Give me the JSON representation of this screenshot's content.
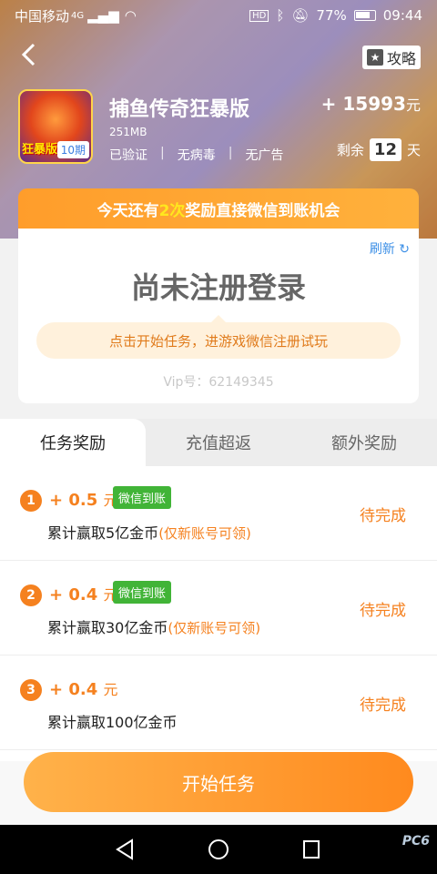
{
  "status": {
    "carrier": "中国移动",
    "network": "4G",
    "hd": "HD",
    "battery": "77%",
    "time": "09:44"
  },
  "header": {
    "guide_label": "攻略"
  },
  "game": {
    "title": "捕鱼传奇狂暴版",
    "size": "251MB",
    "badges": [
      "已验证",
      "无病毒",
      "无广告"
    ],
    "icon_tag": "10期",
    "icon_ribbon": "狂暴版",
    "reward_prefix": "+",
    "reward_value": "15993",
    "reward_unit": "元",
    "remain_label": "剩余",
    "remain_days": "12",
    "remain_unit": "天"
  },
  "banner": {
    "prefix": "今天还有",
    "count": "2次",
    "suffix": "奖励直接微信到账机会"
  },
  "card": {
    "refresh_label": "刷新",
    "headline": "尚未注册登录",
    "tip": "点击开始任务，进游戏微信注册试玩",
    "vip": "Vip号：62149345"
  },
  "tabs": [
    {
      "label": "任务奖励",
      "active": true
    },
    {
      "label": "充值超返",
      "active": false
    },
    {
      "label": "额外奖励",
      "active": false
    }
  ],
  "tasks": [
    {
      "num": "1",
      "amount": "+ 0.5",
      "unit": "元",
      "badge": "微信到账",
      "desc": "累计赢取5亿金币",
      "note": "(仅新账号可领)",
      "status": "待完成"
    },
    {
      "num": "2",
      "amount": "+ 0.4",
      "unit": "元",
      "badge": "微信到账",
      "desc": "累计赢取30亿金币",
      "note": "(仅新账号可领)",
      "status": "待完成"
    },
    {
      "num": "3",
      "amount": "+ 0.4",
      "unit": "元",
      "badge": "",
      "desc": "累计赢取100亿金币",
      "note": "",
      "status": "待完成"
    }
  ],
  "actions": {
    "start_label": "开始任务"
  },
  "watermark": "PC6"
}
